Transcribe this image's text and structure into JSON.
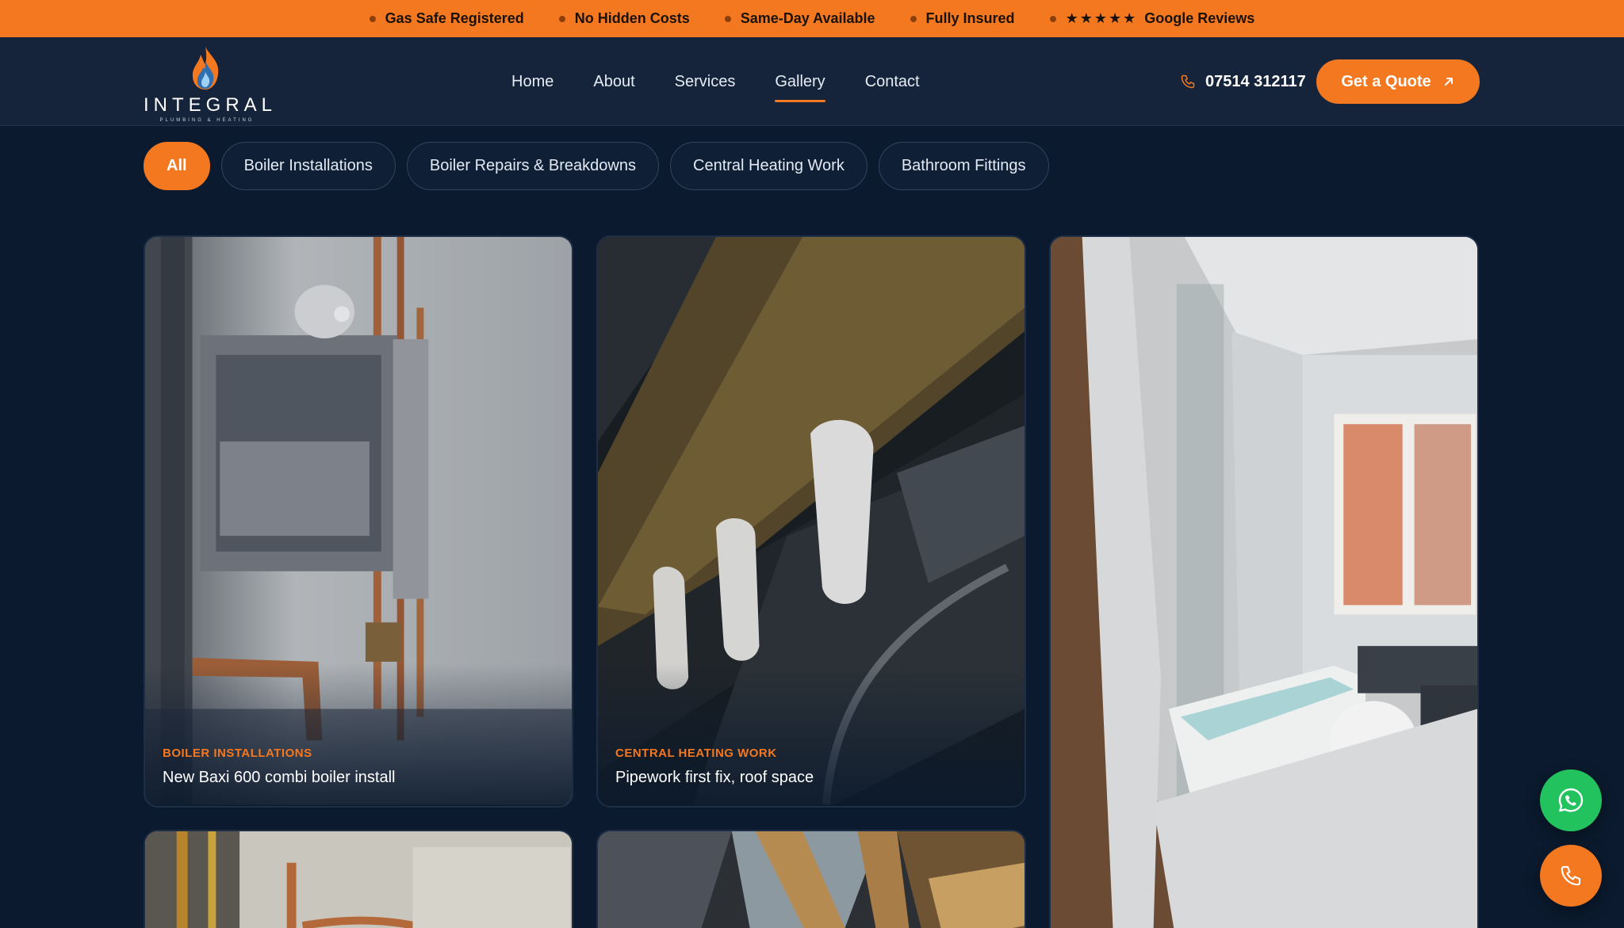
{
  "topbar": {
    "items": [
      "Gas Safe Registered",
      "No Hidden Costs",
      "Same-Day Available",
      "Fully Insured"
    ],
    "reviews_stars": "★★★★★",
    "reviews_label": "Google Reviews"
  },
  "brand": {
    "name": "INTEGRAL",
    "tagline": "PLUMBING & HEATING"
  },
  "nav": {
    "items": [
      "Home",
      "About",
      "Services",
      "Gallery",
      "Contact"
    ],
    "active": "Gallery"
  },
  "header": {
    "phone": "07514 312117",
    "quote_label": "Get a Quote"
  },
  "filters": [
    "All",
    "Boiler Installations",
    "Boiler Repairs & Breakdowns",
    "Central Heating Work",
    "Bathroom Fittings"
  ],
  "gallery": [
    {
      "category": "Boiler Installations",
      "title": "New Baxi 600 combi boiler install"
    },
    {
      "category": "Central Heating Work",
      "title": "Pipework first fix, roof space"
    }
  ],
  "colors": {
    "accent": "#f47820",
    "background": "#0b1a2e",
    "header": "#15243a",
    "whatsapp": "#22c35e"
  },
  "icons": [
    "phone-icon",
    "arrow-up-right-icon",
    "whatsapp-icon",
    "call-icon",
    "flame-icon"
  ]
}
